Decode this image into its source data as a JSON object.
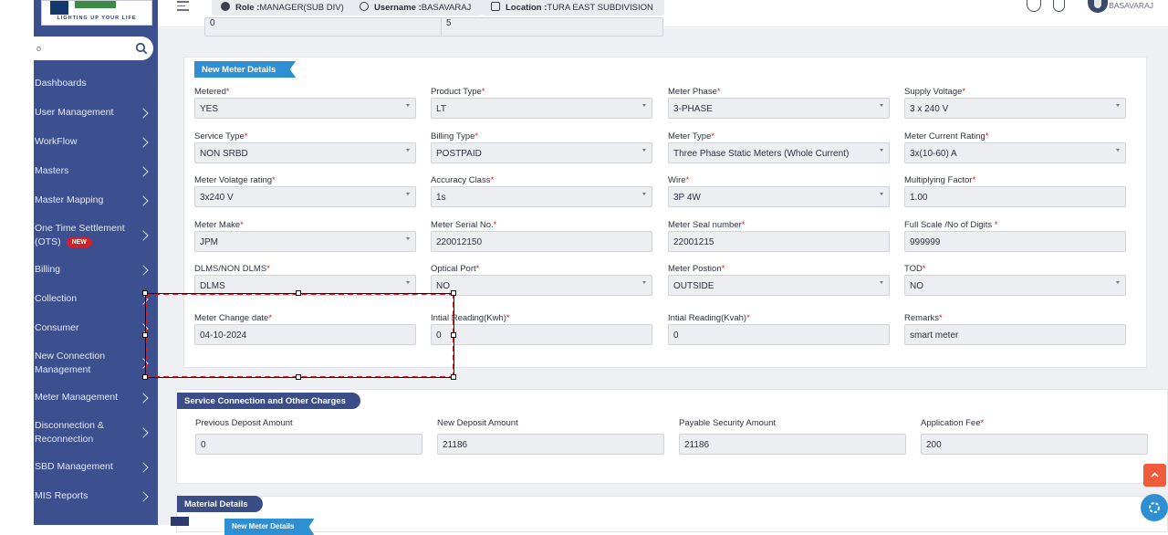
{
  "brand": {
    "logo_text": "LIGHTING UP YOUR LIFE"
  },
  "search": {
    "placeholder": "",
    "value": "o"
  },
  "sidebar": {
    "items": [
      {
        "label": "Dashboards",
        "chevron": false
      },
      {
        "label": "User Management",
        "chevron": true
      },
      {
        "label": "WorkFlow",
        "chevron": true
      },
      {
        "label": "Masters",
        "chevron": true
      },
      {
        "label": "Master Mapping",
        "chevron": true
      },
      {
        "label": "One Time Settlement (OTS)",
        "badge": "NEW",
        "chevron": true
      },
      {
        "label": "Billing",
        "chevron": true
      },
      {
        "label": "Collection",
        "chevron": true
      },
      {
        "label": "Consumer",
        "chevron": true
      },
      {
        "label": "New Connection Management",
        "chevron": true
      },
      {
        "label": "Meter Management",
        "chevron": true
      },
      {
        "label": "Disconnection & Reconnection",
        "chevron": true
      },
      {
        "label": "SBD Management",
        "chevron": true
      },
      {
        "label": "MIS Reports",
        "chevron": true
      }
    ]
  },
  "header": {
    "role_label": "Role :",
    "role_value": "MANAGER(SUB DIV)",
    "username_label": "Username :",
    "username_value": "BASAVARAJ",
    "location_label": "Location :",
    "location_value": "TURA EAST SUBDIVISION",
    "user_display": "BASAVARAJ"
  },
  "partial_fields": {
    "left_value": "0",
    "right_value": "5"
  },
  "new_meter": {
    "title": "New Meter Details",
    "fields": [
      {
        "label": "Metered",
        "required": true,
        "value": "YES",
        "type": "select"
      },
      {
        "label": "Product Type",
        "required": true,
        "value": "LT",
        "type": "select"
      },
      {
        "label": "Meter Phase",
        "required": true,
        "value": "3-PHASE",
        "type": "select"
      },
      {
        "label": "Supply Voltage",
        "required": true,
        "value": "3 x 240 V",
        "type": "select"
      },
      {
        "label": "Service Type",
        "required": true,
        "value": "NON SRBD",
        "type": "select"
      },
      {
        "label": "Billing Type",
        "required": true,
        "value": "POSTPAID",
        "type": "select"
      },
      {
        "label": "Meter Type",
        "required": true,
        "value": "Three Phase Static Meters (Whole Current)",
        "type": "select"
      },
      {
        "label": "Meter Current Rating",
        "required": true,
        "value": "3x(10-60) A",
        "type": "select"
      },
      {
        "label": "Meter Volatge rating",
        "required": true,
        "value": "3x240 V",
        "type": "select"
      },
      {
        "label": "Accuracy Class",
        "required": true,
        "value": "1s",
        "type": "select"
      },
      {
        "label": "Wire",
        "required": true,
        "value": "3P 4W",
        "type": "select"
      },
      {
        "label": "Multiplying Factor",
        "required": true,
        "value": "1.00",
        "type": "input"
      },
      {
        "label": "Meter Make",
        "required": true,
        "value": "JPM",
        "type": "select"
      },
      {
        "label": "Meter Serial No.",
        "required": true,
        "value": "220012150",
        "type": "input"
      },
      {
        "label": "Meter Seal number",
        "required": true,
        "value": "22001215",
        "type": "input"
      },
      {
        "label": "Full Scale /No of Digits ",
        "required": true,
        "value": "999999",
        "type": "input"
      },
      {
        "label": "DLMS/NON DLMS",
        "required": true,
        "value": "DLMS",
        "type": "select"
      },
      {
        "label": "Optical Port",
        "required": true,
        "value": "NO",
        "type": "select"
      },
      {
        "label": "Meter Postion",
        "required": true,
        "value": "OUTSIDE",
        "type": "select"
      },
      {
        "label": "TOD",
        "required": true,
        "value": "NO",
        "type": "select"
      },
      {
        "label": "Meter Change date",
        "required": true,
        "value": "04-10-2024",
        "type": "input"
      },
      {
        "label": "Intial Reading(Kwh)",
        "required": true,
        "value": "0",
        "type": "input"
      },
      {
        "label": "Intial Reading(Kvah)",
        "required": true,
        "value": "0",
        "type": "input"
      },
      {
        "label": "Remarks",
        "required": true,
        "value": "smart meter",
        "type": "input"
      }
    ]
  },
  "service_charges": {
    "title": "Service Connection and Other Charges",
    "fields": [
      {
        "label": "Previous Deposit Amount",
        "required": false,
        "value": "0"
      },
      {
        "label": "New Deposit Amount",
        "required": false,
        "value": "21186"
      },
      {
        "label": "Payable Security Amount",
        "required": false,
        "value": "21186"
      },
      {
        "label": "Application Fee",
        "required": true,
        "value": "200"
      }
    ]
  },
  "material": {
    "title": "Material Details",
    "sub_title_partial": "New Meter Details"
  },
  "colors": {
    "sidebar": "#3c4f8f",
    "accent_blue": "#2e8fd3",
    "required": "#d0222a",
    "scroll_top": "#ef5b3b"
  }
}
